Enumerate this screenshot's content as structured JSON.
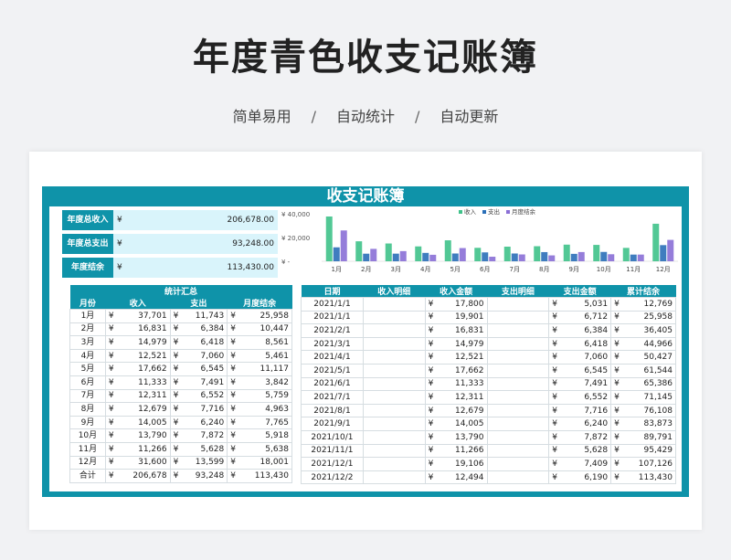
{
  "header": {
    "title": "年度青色收支记账簿",
    "tags": [
      "简单易用",
      "自动统计",
      "自动更新"
    ],
    "separator": "/"
  },
  "sheet": {
    "title": "收支记账簿"
  },
  "currency": "¥",
  "summary": [
    {
      "label": "年度总收入",
      "value": "206,678.00"
    },
    {
      "label": "年度总支出",
      "value": "93,248.00"
    },
    {
      "label": "年度结余",
      "value": "113,430.00"
    }
  ],
  "chart_data": {
    "type": "bar",
    "categories": [
      "1月",
      "2月",
      "3月",
      "4月",
      "5月",
      "6月",
      "7月",
      "8月",
      "9月",
      "10月",
      "11月",
      "12月"
    ],
    "series": [
      {
        "name": "收入",
        "values": [
          37701,
          16831,
          14979,
          12521,
          17662,
          11333,
          12311,
          12679,
          14005,
          13790,
          11266,
          31600
        ]
      },
      {
        "name": "支出",
        "values": [
          11743,
          6384,
          6418,
          7060,
          6545,
          7491,
          6552,
          7716,
          6240,
          7872,
          5628,
          13599
        ]
      },
      {
        "name": "月度结余",
        "values": [
          25958,
          10447,
          8561,
          5461,
          11117,
          3842,
          5759,
          4963,
          7765,
          5918,
          5638,
          18001
        ]
      }
    ],
    "yticks": [
      "¥ 40,000",
      "¥ 20,000",
      "¥ -"
    ],
    "ylim": [
      0,
      40000
    ],
    "legend": "top",
    "colors": {
      "income": "#3fc28a",
      "expense": "#2a6fb8",
      "balance": "#8a6fd6"
    }
  },
  "left_table": {
    "title": "统计汇总",
    "headers": [
      "月份",
      "收入",
      "支出",
      "月度结余"
    ],
    "rows": [
      [
        "1月",
        "37,701",
        "11,743",
        "25,958"
      ],
      [
        "2月",
        "16,831",
        "6,384",
        "10,447"
      ],
      [
        "3月",
        "14,979",
        "6,418",
        "8,561"
      ],
      [
        "4月",
        "12,521",
        "7,060",
        "5,461"
      ],
      [
        "5月",
        "17,662",
        "6,545",
        "11,117"
      ],
      [
        "6月",
        "11,333",
        "7,491",
        "3,842"
      ],
      [
        "7月",
        "12,311",
        "6,552",
        "5,759"
      ],
      [
        "8月",
        "12,679",
        "7,716",
        "4,963"
      ],
      [
        "9月",
        "14,005",
        "6,240",
        "7,765"
      ],
      [
        "10月",
        "13,790",
        "7,872",
        "5,918"
      ],
      [
        "11月",
        "11,266",
        "5,628",
        "5,638"
      ],
      [
        "12月",
        "31,600",
        "13,599",
        "18,001"
      ],
      [
        "合计",
        "206,678",
        "93,248",
        "113,430"
      ]
    ]
  },
  "right_table": {
    "headers": [
      "日期",
      "收入明细",
      "收入金额",
      "支出明细",
      "支出金额",
      "累计结余"
    ],
    "rows": [
      [
        "2021/1/1",
        "",
        "17,800",
        "",
        "5,031",
        "12,769"
      ],
      [
        "2021/1/1",
        "",
        "19,901",
        "",
        "6,712",
        "25,958"
      ],
      [
        "2021/2/1",
        "",
        "16,831",
        "",
        "6,384",
        "36,405"
      ],
      [
        "2021/3/1",
        "",
        "14,979",
        "",
        "6,418",
        "44,966"
      ],
      [
        "2021/4/1",
        "",
        "12,521",
        "",
        "7,060",
        "50,427"
      ],
      [
        "2021/5/1",
        "",
        "17,662",
        "",
        "6,545",
        "61,544"
      ],
      [
        "2021/6/1",
        "",
        "11,333",
        "",
        "7,491",
        "65,386"
      ],
      [
        "2021/7/1",
        "",
        "12,311",
        "",
        "6,552",
        "71,145"
      ],
      [
        "2021/8/1",
        "",
        "12,679",
        "",
        "7,716",
        "76,108"
      ],
      [
        "2021/9/1",
        "",
        "14,005",
        "",
        "6,240",
        "83,873"
      ],
      [
        "2021/10/1",
        "",
        "13,790",
        "",
        "7,872",
        "89,791"
      ],
      [
        "2021/11/1",
        "",
        "11,266",
        "",
        "5,628",
        "95,429"
      ],
      [
        "2021/12/1",
        "",
        "19,106",
        "",
        "7,409",
        "107,126"
      ],
      [
        "2021/12/2",
        "",
        "12,494",
        "",
        "6,190",
        "113,430"
      ]
    ]
  }
}
